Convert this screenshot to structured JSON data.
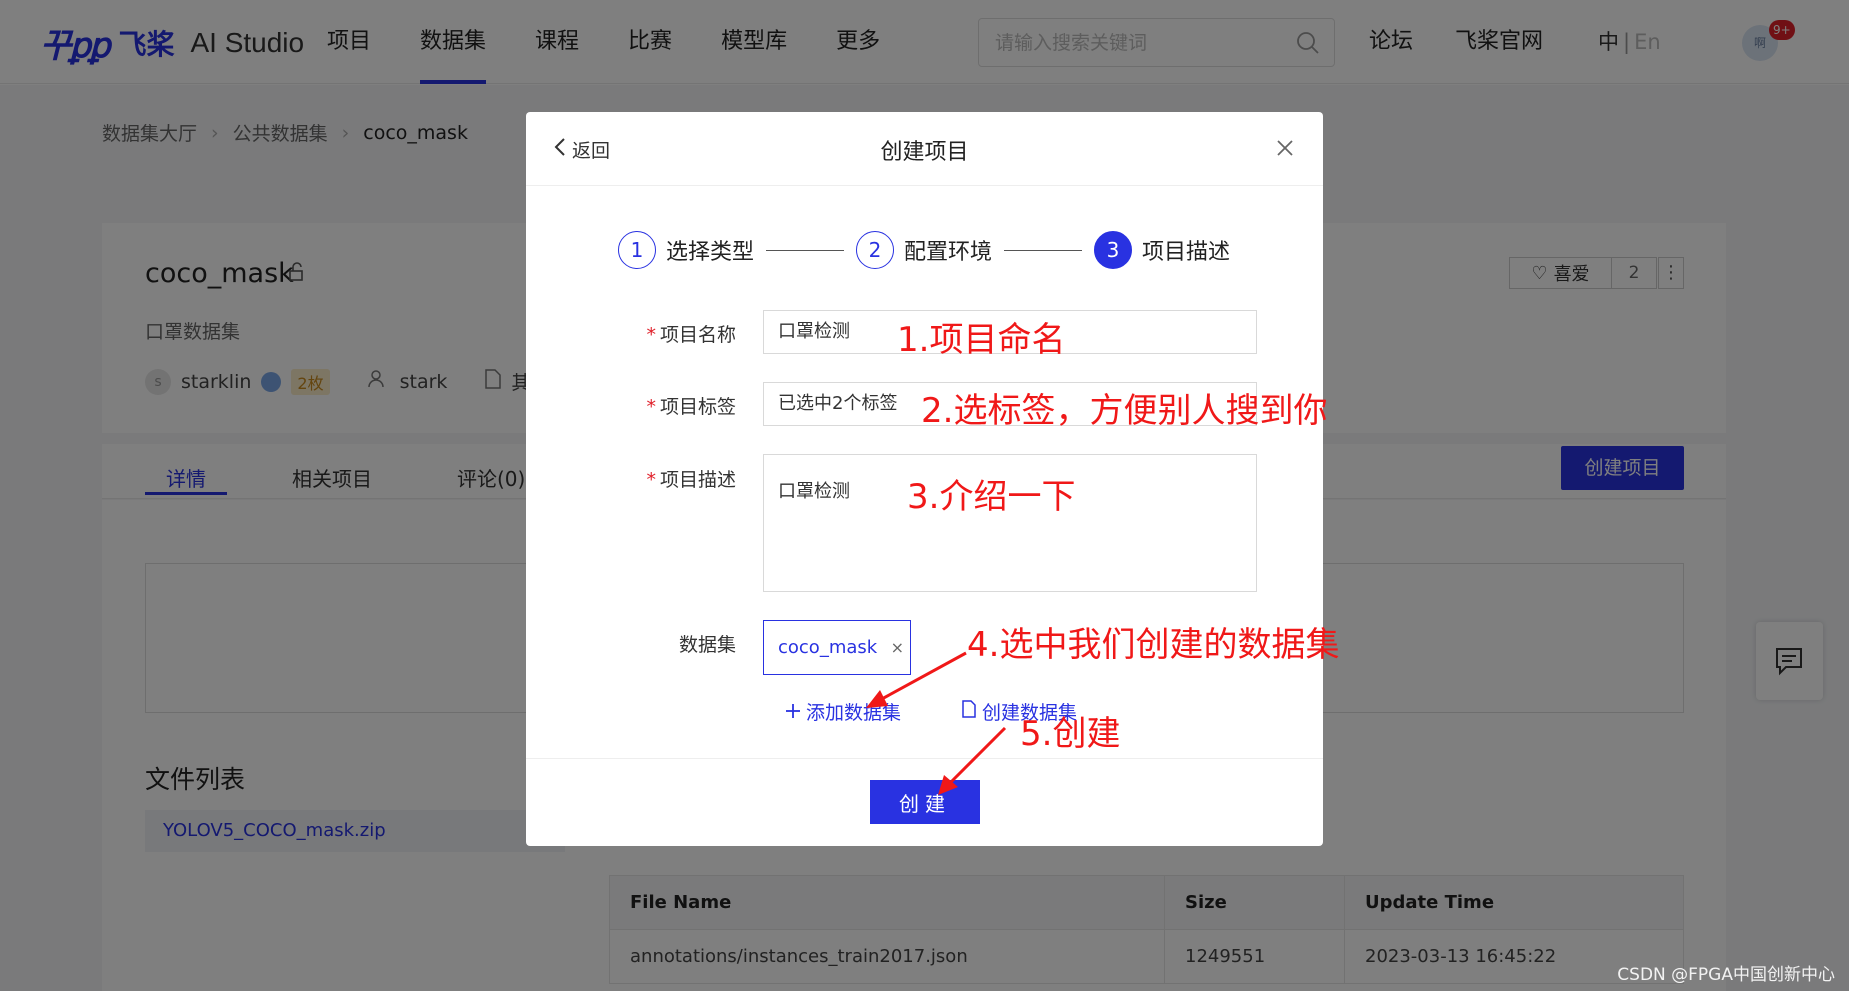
{
  "header": {
    "logo_mark": "꾸ꝑꝑ",
    "logo_cn": "飞桨",
    "logo_en": "AI Studio",
    "nav": [
      "项目",
      "数据集",
      "课程",
      "比赛",
      "模型库",
      "更多"
    ],
    "active_nav": "数据集",
    "search_placeholder": "请输入搜索关键词",
    "forum": "论坛",
    "official_site": "飞桨官网",
    "lang_zh": "中",
    "lang_sep": "|",
    "lang_en": "En",
    "avatar_text": "啊",
    "notification_badge": "9+"
  },
  "breadcrumb": [
    "数据集大厅",
    "公共数据集",
    "coco_mask"
  ],
  "dataset": {
    "name": "coco_mask",
    "subtitle": "口罩数据集",
    "owner_initial": "s",
    "owner": "starklin",
    "coins": "2枚",
    "collaborator": "stark",
    "other": "其",
    "like_label": "喜爱",
    "like_count": "2"
  },
  "tabs": [
    "详情",
    "相关项目",
    "评论(0)"
  ],
  "create_project_label": "创建项目",
  "files": {
    "title": "文件列表",
    "items": [
      "YOLOV5_COCO_mask.zip"
    ],
    "table_headers": [
      "File Name",
      "Size",
      "Update Time"
    ],
    "rows": [
      [
        "annotations/instances_train2017.json",
        "1249551",
        "2023-03-13 16:45:22"
      ]
    ]
  },
  "modal": {
    "back_label": "返回",
    "title": "创建项目",
    "steps": [
      {
        "num": "1",
        "label": "选择类型"
      },
      {
        "num": "2",
        "label": "配置环境"
      },
      {
        "num": "3",
        "label": "项目描述"
      }
    ],
    "active_step": 3,
    "required_mark": "*",
    "name_label": "项目名称",
    "name_value": "口罩检测",
    "tag_label": "项目标签",
    "tag_value": "已选中2个标签",
    "desc_label": "项目描述",
    "desc_value": "口罩检测",
    "dataset_label": "数据集",
    "dataset_chip": "coco_mask",
    "chip_close": "×",
    "add_dataset": "添加数据集",
    "create_dataset": "创建数据集",
    "submit": "创建"
  },
  "annotations": {
    "a1": "1.项目命名",
    "a2": "2.选标签，方便别人搜到你",
    "a3": "3.介绍一下",
    "a4": "4.选中我们创建的数据集",
    "a5": "5.创建",
    "color": "#f01818"
  },
  "watermark": "CSDN @FPGA中国创新中心",
  "colors": {
    "accent": "#2932e1",
    "required": "#e0202a",
    "badge": "#e0202a"
  }
}
